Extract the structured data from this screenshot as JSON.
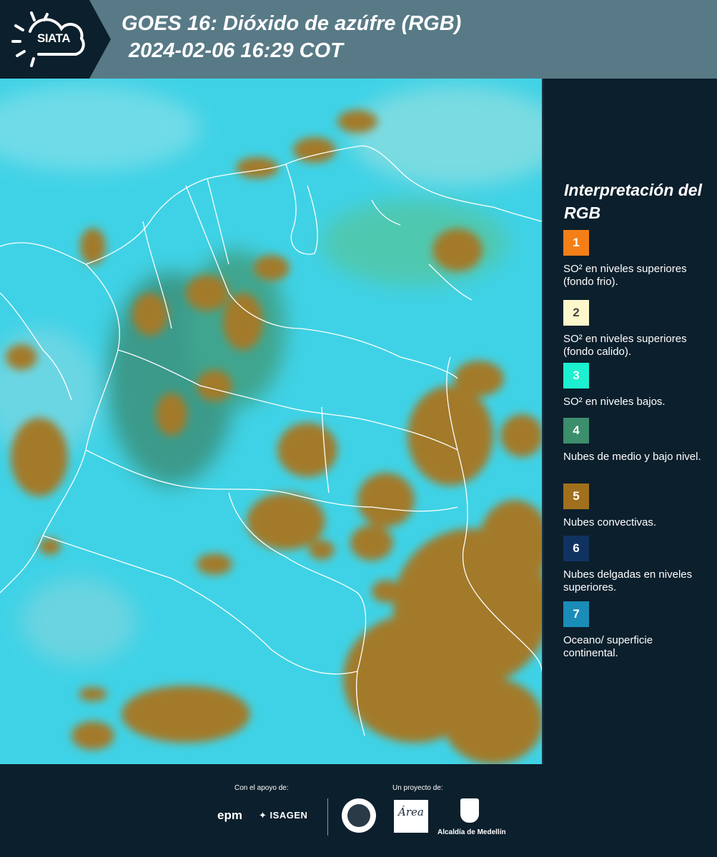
{
  "header": {
    "logo_text": "SIATA",
    "title_line1": "GOES 16: Dióxido de azúfre (RGB)",
    "title_line2": "2024-02-06 16:29 COT"
  },
  "legend": {
    "title": "Interpretación del RGB",
    "items": [
      {
        "number": "1",
        "color": "#f57f17",
        "text_color": "#ffffff",
        "label": "SO² en niveles superiores (fondo frio)."
      },
      {
        "number": "2",
        "color": "#fdf8cc",
        "text_color": "#444444",
        "label": "SO² en niveles superiores (fondo calido)."
      },
      {
        "number": "3",
        "color": "#1cf0d0",
        "text_color": "#ffffff",
        "label": "SO² en niveles bajos."
      },
      {
        "number": "4",
        "color": "#3c8e6c",
        "text_color": "#ffffff",
        "label": "Nubes de medio y bajo nivel."
      },
      {
        "number": "5",
        "color": "#a0701c",
        "text_color": "#ffffff",
        "label": "Nubes convectivas."
      },
      {
        "number": "6",
        "color": "#103260",
        "text_color": "#ffffff",
        "label": "Nubes delgadas en niveles superiores."
      },
      {
        "number": "7",
        "color": "#1a8cb8",
        "text_color": "#ffffff",
        "label": "Oceano/ superficie continental."
      }
    ]
  },
  "footer": {
    "support_label": "Con el apoyo de:",
    "project_label": "Un proyecto de:",
    "epm": "epm",
    "isagen": "ISAGEN",
    "amva": "Área",
    "alcaldia": "Alcaldía de Medellín"
  },
  "map": {
    "ocean_color": "#3fd2e6",
    "cloud_color": "#a27a2c",
    "border_color": "#ffffff"
  }
}
